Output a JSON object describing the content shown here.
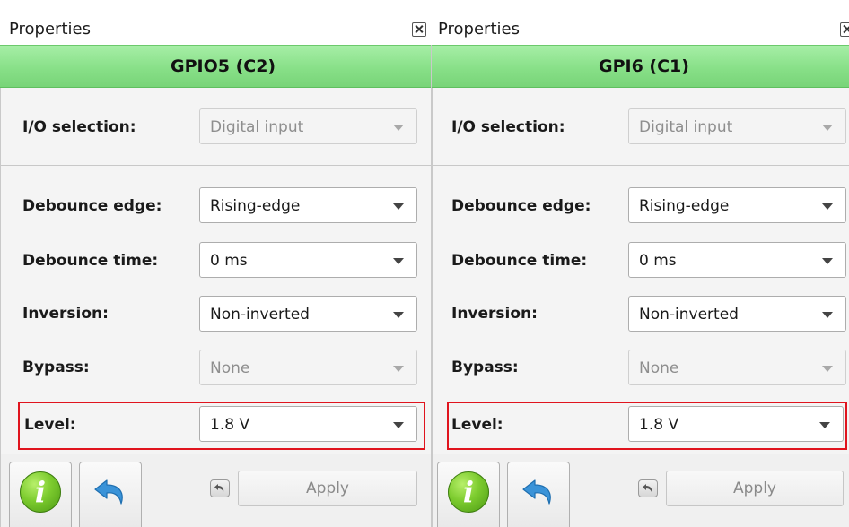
{
  "panels": [
    {
      "title": "Properties",
      "header": "GPIO5 (C2)",
      "io_selection": {
        "label": "I/O selection:",
        "value": "Digital input",
        "enabled": false
      },
      "debounce_edge": {
        "label": "Debounce edge:",
        "value": "Rising-edge"
      },
      "debounce_time": {
        "label": "Debounce time:",
        "value": "0 ms"
      },
      "inversion": {
        "label": "Inversion:",
        "value": "Non-inverted"
      },
      "bypass": {
        "label": "Bypass:",
        "value": "None",
        "enabled": false
      },
      "level": {
        "label": "Level:",
        "value": "1.8 V",
        "highlighted": true
      },
      "apply_label": "Apply"
    },
    {
      "title": "Properties",
      "header": "GPI6 (C1)",
      "io_selection": {
        "label": "I/O selection:",
        "value": "Digital input",
        "enabled": false
      },
      "debounce_edge": {
        "label": "Debounce edge:",
        "value": "Rising-edge"
      },
      "debounce_time": {
        "label": "Debounce time:",
        "value": "0 ms"
      },
      "inversion": {
        "label": "Inversion:",
        "value": "Non-inverted"
      },
      "bypass": {
        "label": "Bypass:",
        "value": "None",
        "enabled": false
      },
      "level": {
        "label": "Level:",
        "value": "1.8 V",
        "highlighted": true
      },
      "apply_label": "Apply"
    }
  ],
  "icons": {
    "close": "close-icon",
    "info": "info-icon",
    "undo": "undo-icon",
    "small_undo": "small-undo-icon"
  },
  "colors": {
    "header_green": "#88e088",
    "highlight_red": "#e0141e",
    "info_green": "#7ccb2e",
    "undo_blue": "#3a93d8"
  }
}
